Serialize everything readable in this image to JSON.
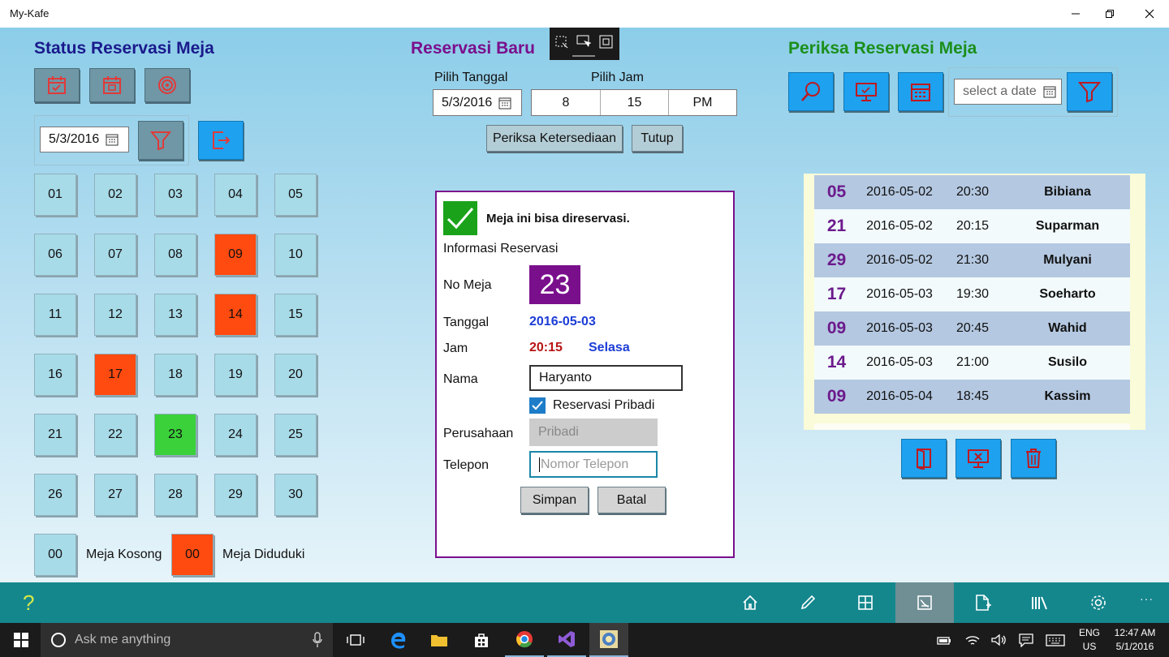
{
  "window": {
    "title": "My-Kafe"
  },
  "left": {
    "title": "Status Reservasi Meja",
    "date_value": "5/3/2016",
    "tables": [
      "01",
      "02",
      "03",
      "04",
      "05",
      "06",
      "07",
      "08",
      "09",
      "10",
      "11",
      "12",
      "13",
      "14",
      "15",
      "16",
      "17",
      "18",
      "19",
      "20",
      "21",
      "22",
      "23",
      "24",
      "25",
      "26",
      "27",
      "28",
      "29",
      "30"
    ],
    "occupied": [
      "09",
      "14",
      "17"
    ],
    "selected": "23",
    "legend": {
      "empty_num": "00",
      "empty_label": "Meja Kosong",
      "occupied_num": "00",
      "occupied_label": "Meja Diduduki"
    }
  },
  "middle": {
    "title": "Reservasi Baru",
    "pick_date_label": "Pilih Tanggal",
    "pick_time_label": "Pilih Jam",
    "date_value": "5/3/2016",
    "hour": "8",
    "minute": "15",
    "ampm": "PM",
    "check_button": "Periksa Ketersediaan",
    "close_button": "Tutup",
    "form": {
      "status_message": "Meja ini bisa direservasi.",
      "section_title": "Informasi Reservasi",
      "table_label": "No Meja",
      "table_value": "23",
      "date_label": "Tanggal",
      "date_value": "2016-05-03",
      "time_label": "Jam",
      "time_value": "20:15",
      "day_value": "Selasa",
      "name_label": "Nama",
      "name_value": "Haryanto",
      "private_label": "Reservasi Pribadi",
      "company_label": "Perusahaan",
      "company_placeholder": "Pribadi",
      "phone_label": "Telepon",
      "phone_placeholder": "Nomor Telepon",
      "save_button": "Simpan",
      "cancel_button": "Batal"
    }
  },
  "right": {
    "title": "Periksa Reservasi Meja",
    "date_placeholder": "select a date",
    "rows": [
      {
        "table": "05",
        "date": "2016-05-02",
        "time": "20:30",
        "name": "Bibiana"
      },
      {
        "table": "21",
        "date": "2016-05-02",
        "time": "20:15",
        "name": "Suparman"
      },
      {
        "table": "29",
        "date": "2016-05-02",
        "time": "21:30",
        "name": "Mulyani"
      },
      {
        "table": "17",
        "date": "2016-05-03",
        "time": "19:30",
        "name": "Soeharto"
      },
      {
        "table": "09",
        "date": "2016-05-03",
        "time": "20:45",
        "name": "Wahid"
      },
      {
        "table": "14",
        "date": "2016-05-03",
        "time": "21:00",
        "name": "Susilo"
      },
      {
        "table": "09",
        "date": "2016-05-04",
        "time": "18:45",
        "name": "Kassim"
      }
    ]
  },
  "appbar": {
    "help": "?",
    "more": "···"
  },
  "taskbar": {
    "search_placeholder": "Ask me anything",
    "lang_1": "ENG",
    "lang_2": "US",
    "time": "12:47 AM",
    "date": "5/1/2016"
  },
  "colors": {
    "occupied": "#ff4a10",
    "selected": "#3ad13a",
    "tile": "#a8dbe8",
    "accent_blue": "#1ea1ef",
    "purple": "#7a0f8c",
    "appbar": "#14878d"
  }
}
